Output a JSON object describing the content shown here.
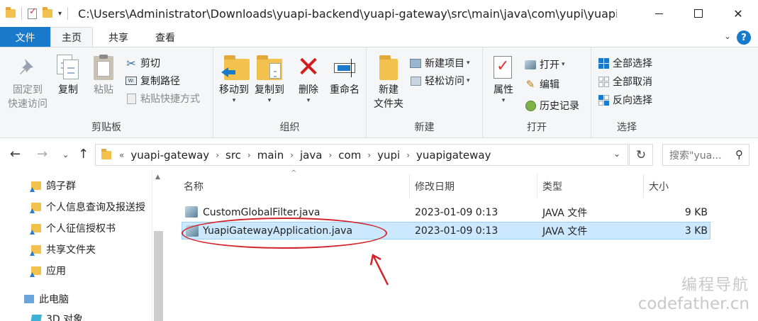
{
  "window": {
    "title": "C:\\Users\\Administrator\\Downloads\\yuapi-backend\\yuapi-gateway\\src\\main\\java\\com\\yupi\\yuapigate..."
  },
  "ribbon_tabs": {
    "file": "文件",
    "home": "主页",
    "share": "共享",
    "view": "查看"
  },
  "ribbon": {
    "clipboard": {
      "pin_line1": "固定到",
      "pin_line2": "快速访问",
      "copy": "复制",
      "paste": "粘贴",
      "cut": "剪切",
      "copy_path": "复制路径",
      "paste_shortcut": "粘贴快捷方式",
      "label": "剪贴板"
    },
    "organize": {
      "move_to": "移动到",
      "copy_to": "复制到",
      "delete": "删除",
      "rename": "重命名",
      "label": "组织"
    },
    "new": {
      "new_folder_line1": "新建",
      "new_folder_line2": "文件夹",
      "new_item": "新建项目",
      "easy_access": "轻松访问",
      "label": "新建"
    },
    "open": {
      "properties": "属性",
      "open": "打开",
      "edit": "编辑",
      "history": "历史记录",
      "label": "打开"
    },
    "select": {
      "select_all": "全部选择",
      "select_none": "全部取消",
      "invert": "反向选择",
      "label": "选择"
    }
  },
  "address": {
    "breadcrumbs": [
      "yuapi-gateway",
      "src",
      "main",
      "java",
      "com",
      "yupi",
      "yuapigateway"
    ],
    "search_placeholder": "搜索\"yua...",
    "overflow": "«"
  },
  "nav_pane": {
    "items": [
      {
        "label": "鸽子群"
      },
      {
        "label": "个人信息查询及报送授"
      },
      {
        "label": "个人征信授权书"
      },
      {
        "label": "共享文件夹"
      },
      {
        "label": "应用"
      },
      {
        "label": "此电脑"
      },
      {
        "label": "3D 对象"
      }
    ]
  },
  "file_list": {
    "columns": {
      "name": "名称",
      "modified": "修改日期",
      "type": "类型",
      "size": "大小"
    },
    "rows": [
      {
        "name": "CustomGlobalFilter.java",
        "modified": "2023-01-09 0:13",
        "type": "JAVA 文件",
        "size": "9 KB"
      },
      {
        "name": "YuapiGatewayApplication.java",
        "modified": "2023-01-09 0:13",
        "type": "JAVA 文件",
        "size": "3 KB"
      }
    ]
  },
  "watermark": {
    "line1": "编程导航",
    "line2": "codefather.cn"
  },
  "colors": {
    "accent": "#1979ca",
    "selection": "#cce8ff",
    "annotation": "#d2232a"
  }
}
